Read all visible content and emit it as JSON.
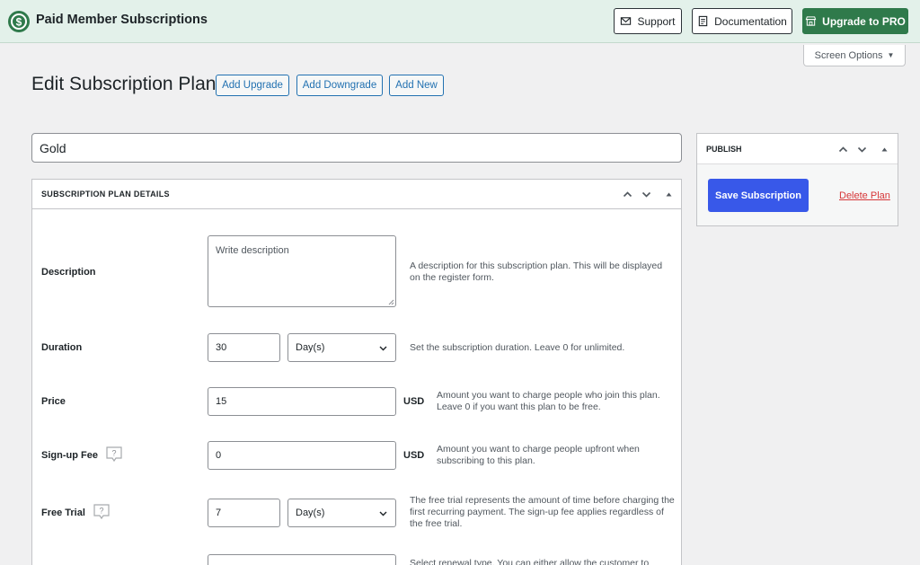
{
  "header": {
    "brand": "Paid Member Subscriptions",
    "support_label": "Support",
    "documentation_label": "Documentation",
    "upgrade_label": "Upgrade to PRO",
    "brand_color": "#2f7a4b"
  },
  "screen_options": {
    "label": "Screen Options"
  },
  "page": {
    "title": "Edit Subscription Plan",
    "buttons": {
      "add_upgrade": "Add Upgrade",
      "add_downgrade": "Add Downgrade",
      "add_new": "Add New"
    },
    "plan_name": "Gold"
  },
  "details": {
    "header": "SUBSCRIPTION PLAN DETAILS",
    "description": {
      "label": "Description",
      "placeholder": "Write description",
      "help": "A description for this subscription plan. This will be displayed on the register form."
    },
    "duration": {
      "label": "Duration",
      "value": "30",
      "unit": "Day(s)",
      "help": "Set the subscription duration. Leave 0 for unlimited."
    },
    "price": {
      "label": "Price",
      "value": "15",
      "currency": "USD",
      "help": "Amount you want to charge people who join this plan. Leave 0 if you want this plan to be free."
    },
    "signup_fee": {
      "label": "Sign-up Fee",
      "value": "0",
      "currency": "USD",
      "help": "Amount you want to charge people upfront when subscribing to this plan."
    },
    "free_trial": {
      "label": "Free Trial",
      "value": "7",
      "unit": "Day(s)",
      "help": "The free trial represents the amount of time before charging the first recurring payment. The sign-up fee applies regardless of the free trial."
    },
    "renewal": {
      "help": "Select renewal type. You can either allow the customer to"
    }
  },
  "publish": {
    "header": "PUBLISH",
    "save_label": "Save Subscription",
    "delete_label": "Delete Plan",
    "accent_color": "#3858e9",
    "delete_color": "#d63638"
  }
}
